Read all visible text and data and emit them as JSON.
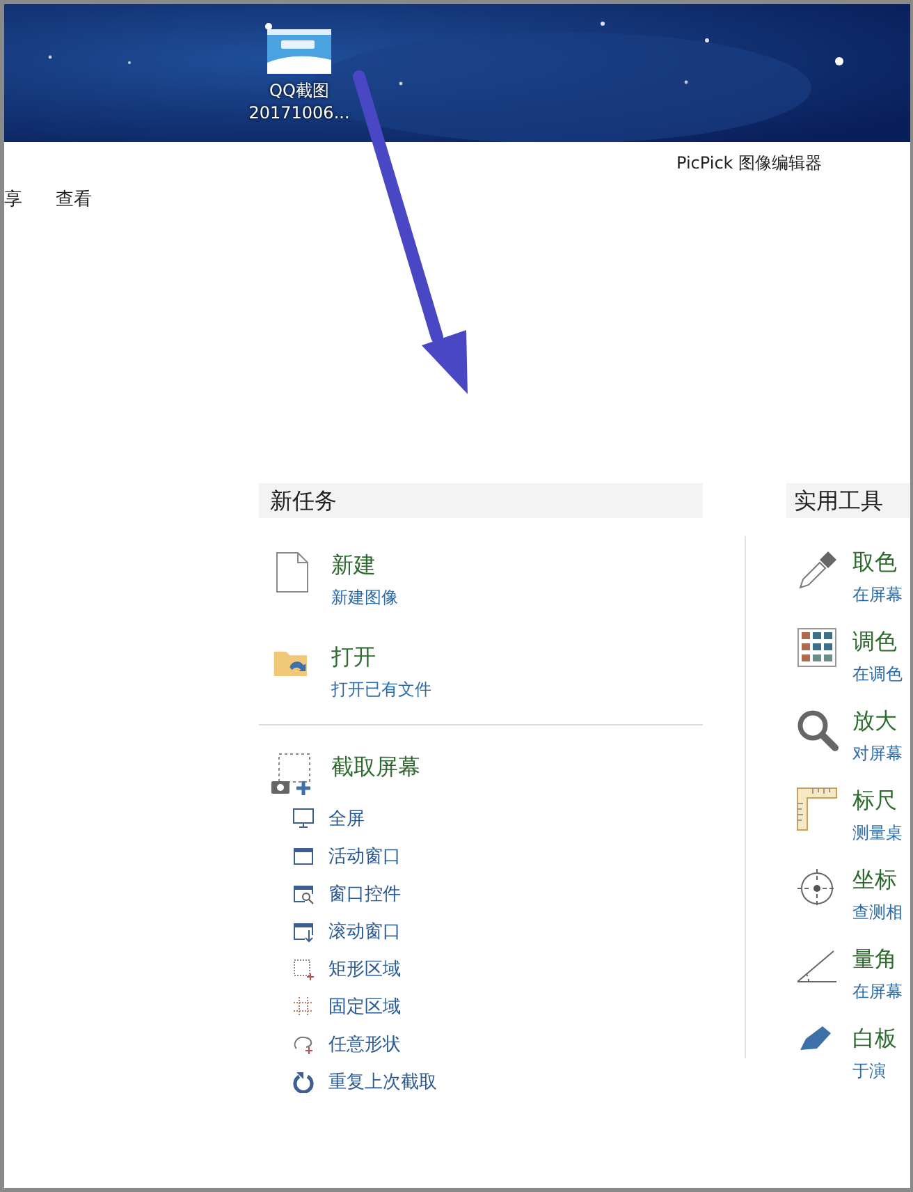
{
  "desktop": {
    "icon_label": "QQ截图\n20171006..."
  },
  "window": {
    "title": "PicPick 图像编辑器",
    "menu": [
      "享",
      "查看"
    ]
  },
  "new_task": {
    "heading": "新任务",
    "actions": [
      {
        "kind": "new",
        "title": "新建",
        "subtitle": "新建图像"
      },
      {
        "kind": "open",
        "title": "打开",
        "subtitle": "打开已有文件"
      }
    ],
    "capture": {
      "title": "截取屏幕",
      "items": [
        {
          "kind": "fullscreen",
          "label": "全屏"
        },
        {
          "kind": "active",
          "label": "活动窗口"
        },
        {
          "kind": "control",
          "label": "窗口控件"
        },
        {
          "kind": "scroll",
          "label": "滚动窗口"
        },
        {
          "kind": "rect",
          "label": "矩形区域"
        },
        {
          "kind": "fixed",
          "label": "固定区域"
        },
        {
          "kind": "freehand",
          "label": "任意形状"
        },
        {
          "kind": "repeat",
          "label": "重复上次截取"
        }
      ]
    }
  },
  "tools": {
    "heading": "实用工具",
    "items": [
      {
        "kind": "picker",
        "title": "取色",
        "subtitle": "在屏幕"
      },
      {
        "kind": "palette",
        "title": "调色",
        "subtitle": "在调色"
      },
      {
        "kind": "magnifier",
        "title": "放大",
        "subtitle": "对屏幕"
      },
      {
        "kind": "ruler",
        "title": "标尺",
        "subtitle": "测量桌"
      },
      {
        "kind": "crosshair",
        "title": "坐标",
        "subtitle": "查测相"
      },
      {
        "kind": "protractor",
        "title": "量角",
        "subtitle": "在屏幕"
      },
      {
        "kind": "whiteboard",
        "title": "白板",
        "subtitle": "于演"
      }
    ]
  }
}
